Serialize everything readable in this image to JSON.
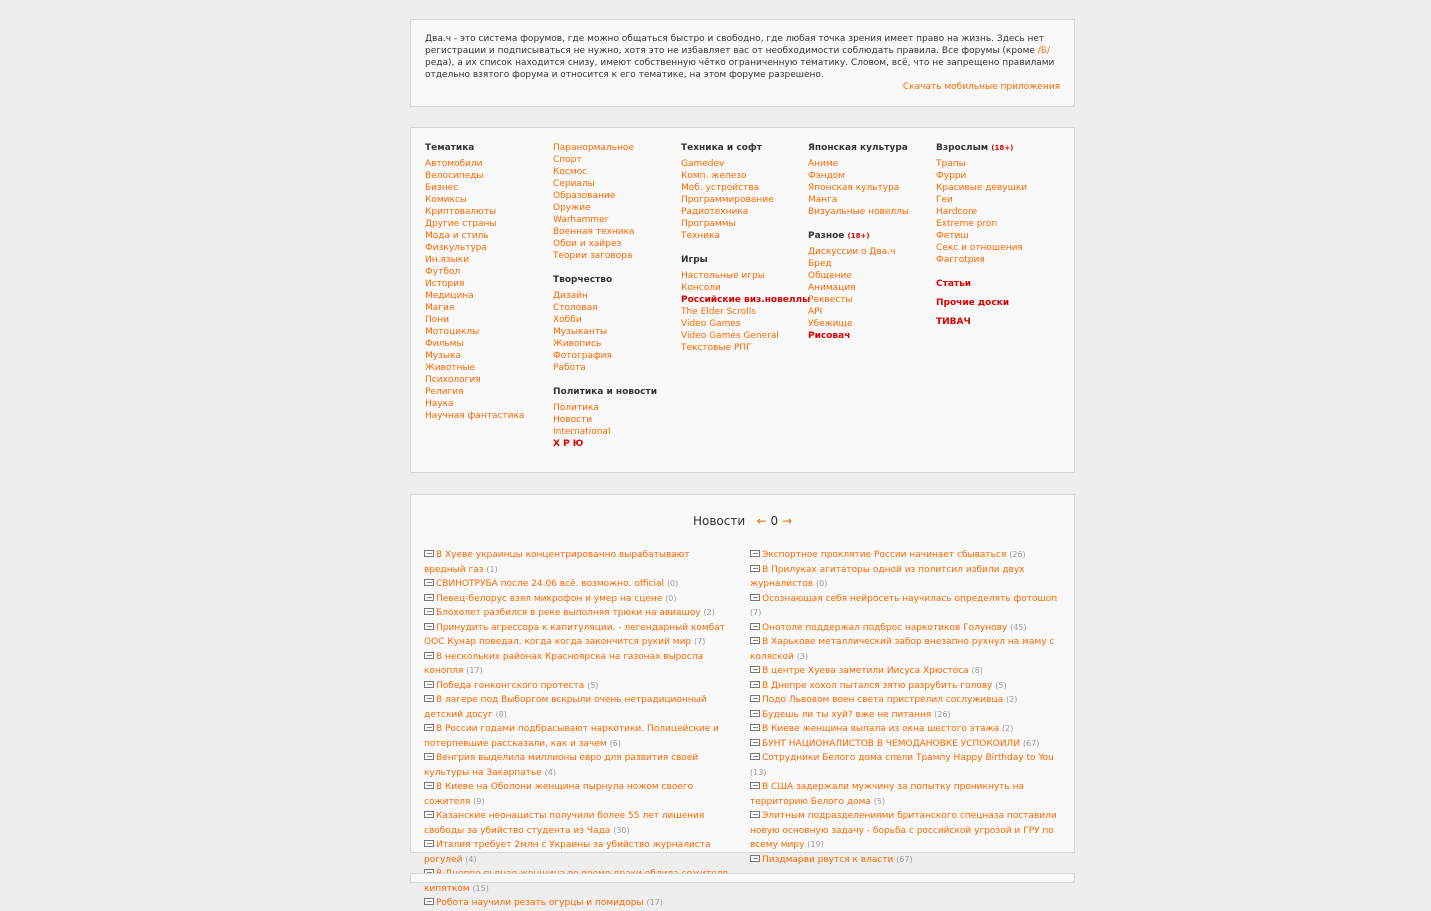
{
  "intro": {
    "text_1": "Два.ч - это система форумов, где можно общаться быстро и свободно, где любая точка зрения имеет право на жизнь. Здесь нет регистрации и подписываться не нужно, хотя это не избавляет вас от необходимости соблюдать правила. Все форумы (кроме ",
    "b_link": "/Б/",
    "text_2": "реда), а их список находится снизу, имеют собственную чётко ограниченную тематику. Словом, всё, что не запрещено правилами отдельно взятого форума и относится к его тематике, на этом форуме разрешено.",
    "apps_link": "Скачать мобильные приложения"
  },
  "boards": {
    "col1": {
      "title": "Тематика",
      "items": [
        "Автомобили",
        "Велосипеды",
        "Бизнес",
        "Комиксы",
        "Криптовалюты",
        "Другие страны",
        "Мода и стиль",
        "Физкультура",
        "Ин.языки",
        "Футбол",
        "История",
        "Медицина",
        "Магия",
        "Пони",
        "Мотоциклы",
        "Фильмы",
        "Музыка",
        "Животные",
        "Психология",
        "Религия",
        "Наука",
        "Научная фантастика"
      ]
    },
    "col2": {
      "items_top": [
        "Паранормальное",
        "Спорт",
        "Космос",
        "Сериалы",
        "Образование",
        "Оружие",
        "Warhammer",
        "Военная техника",
        "Обои и хайрез",
        "Теории заговора"
      ],
      "creative_title": "Творчество",
      "creative_items": [
        "Дизайн",
        "Столовая",
        "Хобби",
        "Музыканты",
        "Живопись",
        "Фотография",
        "Работа"
      ],
      "politics_title": "Политика и новости",
      "politics_items": [
        "Политика",
        "Новости",
        "International"
      ],
      "politics_special": "Х Р Ю"
    },
    "col3": {
      "title": "Техника и софт",
      "items": [
        "Gamedev",
        "Комп. железо",
        "Моб. устройства",
        "Программирование",
        "Радиотехника",
        "Программы",
        "Техника"
      ],
      "games_title": "Игры",
      "games_items_1": [
        "Настольные игры",
        "Консоли"
      ],
      "games_special": "Российские виз.новеллы",
      "games_items_2": [
        "The Elder Scrolls",
        "Video Games",
        "Video Games General",
        "Текстовые РПГ"
      ]
    },
    "col4": {
      "title": "Японская культура",
      "items": [
        "Аниме",
        "Фэндом",
        "Японская культура",
        "Манга",
        "Визуальные новеллы"
      ],
      "misc_title": "Разное",
      "misc_badge": "(18+)",
      "misc_items": [
        "Дискуссии о Два.ч",
        "Бред",
        "Общение",
        "Анимация",
        "Реквесты",
        "API",
        "Убежище"
      ],
      "misc_special": "Рисовач"
    },
    "col5": {
      "title": "Взрослым",
      "badge": "(18+)",
      "items": [
        "Трапы",
        "Фурри",
        "Красивые девушки",
        "Геи",
        "Hardcore",
        "Extreme pron",
        "Фетиш",
        "Секс и отношения",
        "Фаггоtрия"
      ],
      "articles": "Статьи",
      "other_boards": "Прочие доски",
      "tivach": "ТИВАЧ"
    }
  },
  "news": {
    "title": "Новости",
    "prev": "←",
    "page": "0",
    "next": "→",
    "left": [
      {
        "t": "В Хуеве украинцы концентрированно вырабатывают вредный газ",
        "c": "(1)"
      },
      {
        "t": "СВИНОТРУБА после 24.06 всё. возможно. official",
        "c": "(0)"
      },
      {
        "t": "Певец-белорус взял микрофон и умер на сцене",
        "c": "(0)"
      },
      {
        "t": "Блохолет разбился в реке выполняя трюки на авиашоу",
        "c": "(2)"
      },
      {
        "t": "Принудить агрессора к капитуляции. - легендарный комбат ООС Кунар поведал, когда когда закончится рукий мир",
        "c": "(7)"
      },
      {
        "t": "В нескольких районах Красноярска на газонах выросла конопля",
        "c": "(17)"
      },
      {
        "t": "Победа гонконгского протеста",
        "c": "(5)"
      },
      {
        "t": "В лагере под Выборгом вскрыли очень нетрадиционный детский досуг",
        "c": "(8)"
      },
      {
        "t": "В России годами подбрасывают наркотики. Полицейские и потерпевшие рассказали, как и зачем",
        "c": "(6)"
      },
      {
        "t": "Венгрия выделила миллионы евро для развития своей культуры на Закарпатье",
        "c": "(4)"
      },
      {
        "t": "В Киеве на Оболони женщина пырнула ножом своего сожителя",
        "c": "(9)"
      },
      {
        "t": "Казанские неонацисты получили более 55 лет лишения свободы за убийство студента из Чада",
        "c": "(30)"
      },
      {
        "t": "Италия требует 2млн с Украины за убийство журналиста рогулей",
        "c": "(4)"
      },
      {
        "t": "В Днепре пьяная женщина во время драки облила сожителя кипятком",
        "c": "(15)"
      },
      {
        "t": "Робота научили резать огурцы и помидоры",
        "c": "(17)"
      }
    ],
    "right": [
      {
        "t": "Экспортное проклятие России начинает сбываться",
        "c": "(26)"
      },
      {
        "t": "В Прилуках агитаторы одной из политсил избили двух журналистов",
        "c": "(0)"
      },
      {
        "t": "Осознающая себя нейросеть научилась определять фотошоп",
        "c": "(7)"
      },
      {
        "t": "Онотоле поддержал подброс наркотиков Голунову",
        "c": "(45)"
      },
      {
        "t": "В Харькове металлический забор внезапно рухнул на маму с коляской",
        "c": "(3)"
      },
      {
        "t": "В центре Хуева заметили Иисуса Хрюстоса",
        "c": "(8)"
      },
      {
        "t": "В Днепре хохол пытался зятю разрубить голову",
        "c": "(5)"
      },
      {
        "t": "Подо Львовом воен света пристрелил сослуживца",
        "c": "(2)"
      },
      {
        "t": "Будешь ли ты хуй? вже не питання",
        "c": "(26)"
      },
      {
        "t": "В Киеве женщина выпала из окна шестого этажа",
        "c": "(2)"
      },
      {
        "t": "БУНТ НАЦИОНАЛИСТОВ В ЧЕМОДАНОВКЕ УСПОКОИЛИ",
        "c": "(67)"
      },
      {
        "t": "Сотрудники Белого дома спели Трампу Happy Birthday to You",
        "c": "(13)"
      },
      {
        "t": "В США задержали мужчину за попытку проникнуть на территорию Белого дома",
        "c": "(5)"
      },
      {
        "t": "Элитным подразделениями британского спецназа поставили новую основную задачу - борьба с российской угрозой и ГРУ по всему миру",
        "c": "(19)"
      },
      {
        "t": "Пиздмарви рвутся к власти",
        "c": "(67)"
      }
    ]
  },
  "colors": {
    "link": "#ff6600",
    "special": "#dd0000",
    "background": "#eeeeee",
    "panel": "#f9f9f9"
  },
  "icons": {
    "news_item": "news-icon"
  }
}
